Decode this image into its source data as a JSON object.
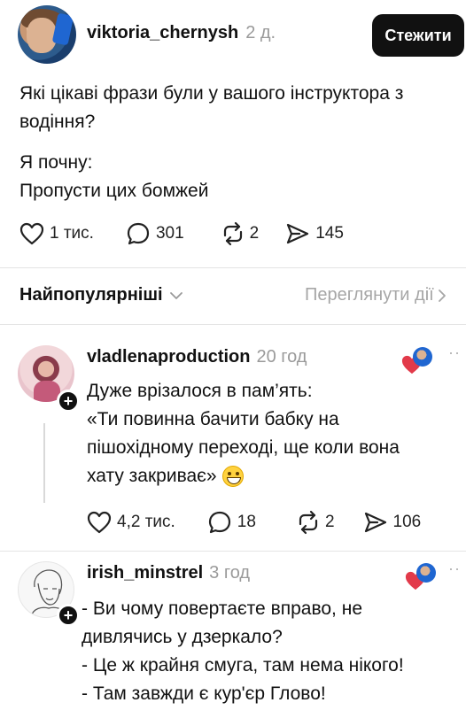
{
  "post": {
    "username": "viktoria_chernysh",
    "time": "2 д.",
    "follow_label": "Стежити",
    "text_line1": "Які цікаві фрази були у вашого інструктора з",
    "text_line2": "водіння?",
    "text_line3": "Я почну:",
    "text_line4": "Пропусти цих бомжей",
    "likes": "1 тис.",
    "comments": "301",
    "reposts": "2",
    "shares": "145"
  },
  "sort": {
    "label": "Найпопулярніші",
    "view_activity": "Переглянути дії"
  },
  "comments": [
    {
      "username": "vladlenaproduction",
      "time": "20 год",
      "line1": "Дуже врізалося в пам’ять:",
      "line2": "«Ти повинна бачити бабку на",
      "line3": "пішохідному переході, ще коли вона",
      "line4": "хату закриває»",
      "likes": "4,2 тис.",
      "comments": "18",
      "reposts": "2",
      "shares": "106"
    },
    {
      "username": "irish_minstrel",
      "time": "3 год",
      "line1": "- Ви чому повертаєте вправо, не",
      "line2": "дивлячись у дзеркало?",
      "line3": "- Це ж крайня смуга, там нема нікого!",
      "line4": "- Там завжди є кур'єр Глово!"
    }
  ],
  "colors": {
    "liked_heart": "#e23a4a",
    "muted_text": "#9a9a9a"
  }
}
